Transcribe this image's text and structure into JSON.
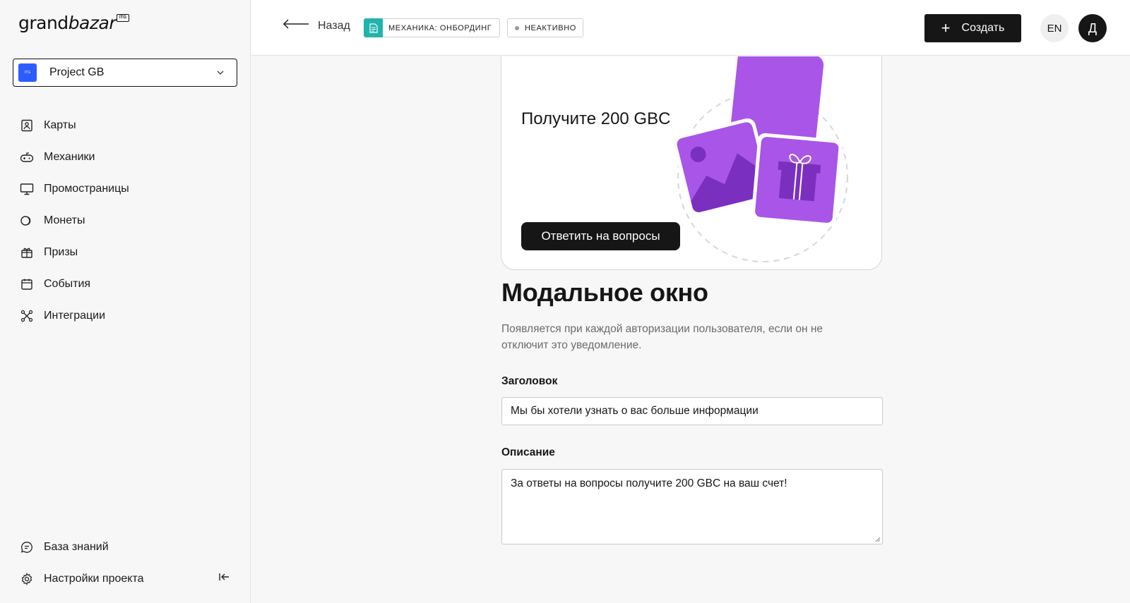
{
  "brand": {
    "name_part1": "grand",
    "name_part2": "bazar",
    "badge": "ITG"
  },
  "project": {
    "name": "Project GB",
    "avatar_text": "ITG"
  },
  "nav": {
    "items": [
      {
        "label": "Карты",
        "icon": "map-card-icon"
      },
      {
        "label": "Механики",
        "icon": "gamepad-icon"
      },
      {
        "label": "Промостраницы",
        "icon": "monitor-icon"
      },
      {
        "label": "Монеты",
        "icon": "coins-icon"
      },
      {
        "label": "Призы",
        "icon": "gift-icon"
      },
      {
        "label": "События",
        "icon": "calendar-icon"
      },
      {
        "label": "Интеграции",
        "icon": "integrations-icon"
      }
    ],
    "bottom": [
      {
        "label": "База знаний",
        "icon": "knowledge-icon"
      },
      {
        "label": "Настройки проекта",
        "icon": "settings-icon"
      }
    ]
  },
  "header": {
    "back_label": "Назад",
    "type_chip": "МЕХАНИКА: ОНБОРДИНГ",
    "status_chip": "НЕАКТИВНО",
    "create_label": "Создать",
    "lang": "EN",
    "user_initial": "Д"
  },
  "promo": {
    "title": "Получите 200 GBC",
    "button_label": "Ответить на вопросы"
  },
  "modal_section": {
    "title": "Модальное окно",
    "description": "Появляется при каждой авторизации пользователя, если он не отключит это уведомление.",
    "heading_label": "Заголовок",
    "heading_value": "Мы бы хотели узнать о вас больше информации",
    "description_label": "Описание",
    "description_value": "За ответы на вопросы получите 200 GBC на ваш счет!"
  },
  "colors": {
    "accent_teal": "#21b3ad",
    "primary_dark": "#161616",
    "purple": "#a855f7",
    "project_blue": "#2c5cff"
  }
}
